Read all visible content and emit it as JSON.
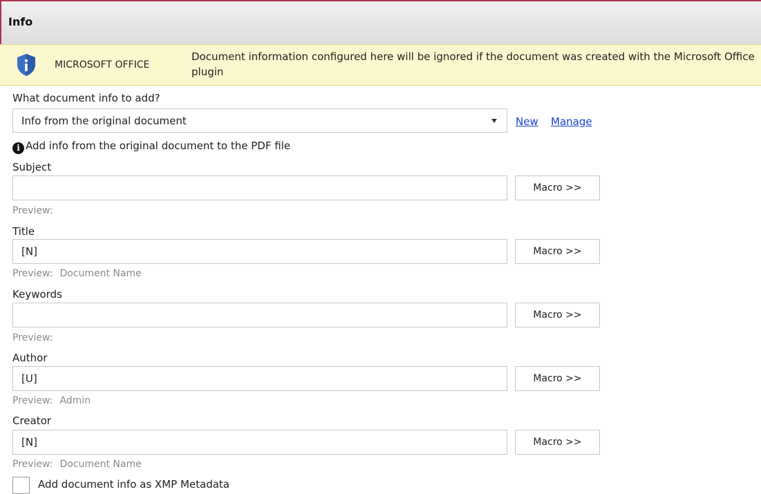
{
  "header": {
    "title": "Info"
  },
  "banner": {
    "icon": "shield-info-icon",
    "product": "MICROSOFT OFFICE",
    "message": "Document information configured here will be ignored if the document was created with the Microsoft Office plugin",
    "background_color": "#fcf8cd",
    "shield_color": "#3a6fc4"
  },
  "doc_info": {
    "label": "What document info to add?",
    "selected": "Info from the original document",
    "new_link": "New",
    "manage_link": "Manage",
    "description": "Add info from the original document to the PDF file",
    "link_color": "#1a3fd6"
  },
  "fields": {
    "subject": {
      "label": "Subject",
      "value": "",
      "preview_label": "Preview:",
      "preview_value": "",
      "macro_label": "Macro >>"
    },
    "title": {
      "label": "Title",
      "value": "[N]",
      "preview_label": "Preview:",
      "preview_value": "Document Name",
      "macro_label": "Macro >>"
    },
    "keywords": {
      "label": "Keywords",
      "value": "",
      "preview_label": "Preview:",
      "preview_value": "",
      "macro_label": "Macro >>"
    },
    "author": {
      "label": "Author",
      "value": "[U]",
      "preview_label": "Preview:",
      "preview_value": "Admin",
      "macro_label": "Macro >>"
    },
    "creator": {
      "label": "Creator",
      "value": "[N]",
      "preview_label": "Preview:",
      "preview_value": "Document Name",
      "macro_label": "Macro >>"
    }
  },
  "xmp": {
    "label": "Add document info as XMP Metadata",
    "checked": false
  },
  "colors": {
    "header_border": "#b0304f"
  }
}
